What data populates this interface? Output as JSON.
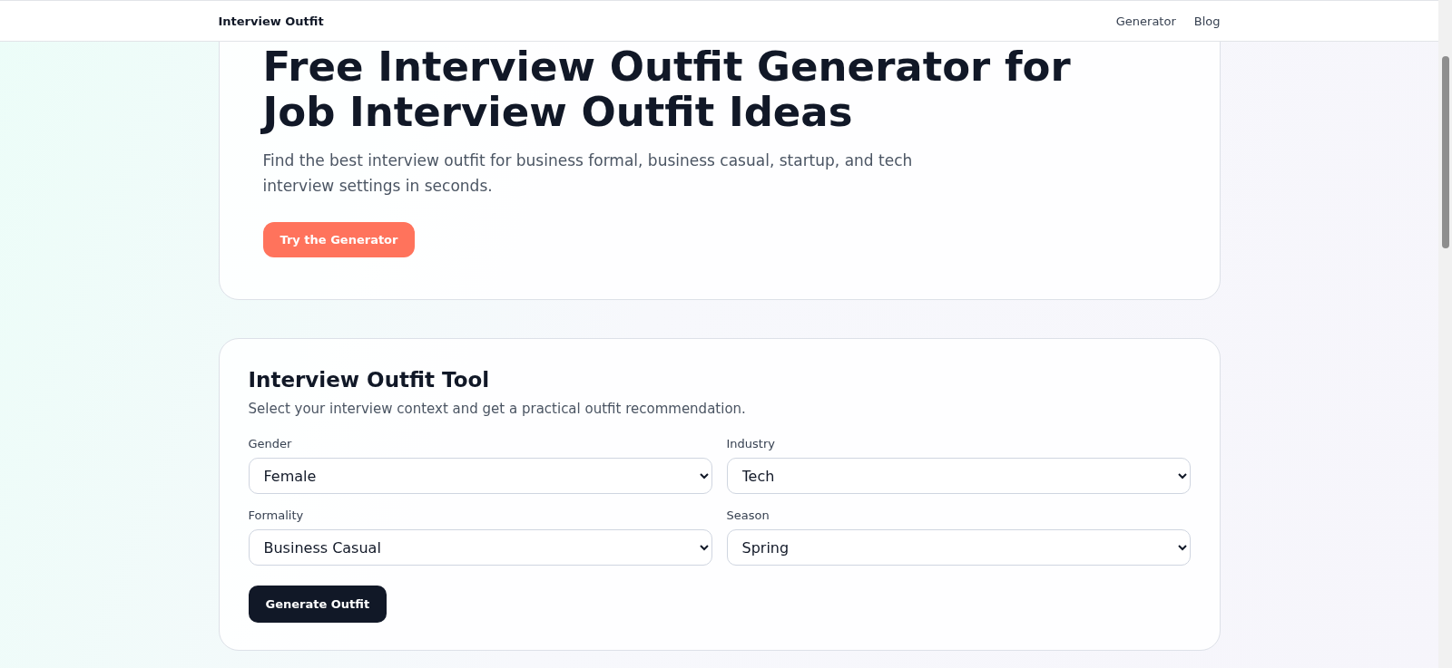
{
  "nav": {
    "brand": "Interview Outfit",
    "links": [
      "Generator",
      "Blog"
    ]
  },
  "hero": {
    "title": "Free Interview Outfit Generator for Job Interview Outfit Ideas",
    "subtitle": "Find the best interview outfit for business formal, business casual, startup, and tech interview settings in seconds.",
    "button": "Try the Generator"
  },
  "tool": {
    "title": "Interview Outfit Tool",
    "description": "Select your interview context and get a practical outfit recommendation.",
    "fields": [
      {
        "label": "Gender",
        "value": "Female"
      },
      {
        "label": "Industry",
        "value": "Tech"
      },
      {
        "label": "Formality",
        "value": "Business Casual"
      },
      {
        "label": "Season",
        "value": "Spring"
      }
    ],
    "button": "Generate Outfit"
  }
}
